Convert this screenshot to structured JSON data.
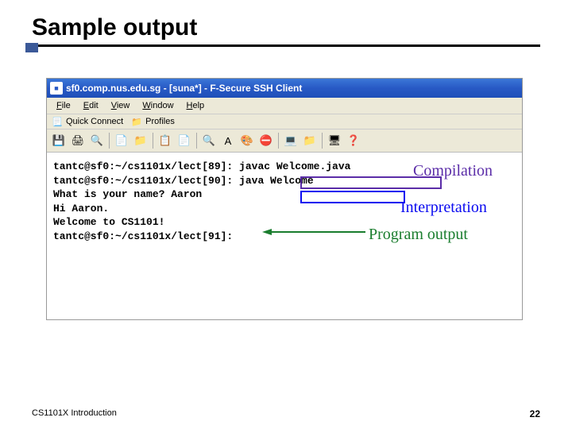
{
  "slide": {
    "title": "Sample output",
    "footer_left": "CS1101X Introduction",
    "slide_number": "22"
  },
  "window": {
    "title": "sf0.comp.nus.edu.sg - [suna*] - F-Secure SSH Client"
  },
  "menubar": [
    "File",
    "Edit",
    "View",
    "Window",
    "Help"
  ],
  "quickbar": {
    "quick_connect": "Quick Connect",
    "profiles": "Profiles"
  },
  "terminal": {
    "lines": [
      "tantc@sf0:~/cs1101x/lect[89]: javac Welcome.java",
      "tantc@sf0:~/cs1101x/lect[90]: java Welcome",
      "What is your name? Aaron",
      "Hi Aaron.",
      "Welcome to CS1101!",
      "",
      "tantc@sf0:~/cs1101x/lect[91]:"
    ]
  },
  "annotations": {
    "compilation": "Compilation",
    "interpretation": "Interpretation",
    "program_output": "Program output"
  },
  "icons": {
    "save": "💾",
    "print": "🖨",
    "preview": "🔍",
    "new": "📄",
    "folder": "📁",
    "copy": "📋",
    "paste": "📄",
    "find": "🔍",
    "a": "A",
    "colors": "🎨",
    "disconnect": "⛔",
    "term": "💻",
    "folder2": "📁",
    "pc": "🖥",
    "help": "❓",
    "doc": "📃",
    "prof": "📁"
  }
}
